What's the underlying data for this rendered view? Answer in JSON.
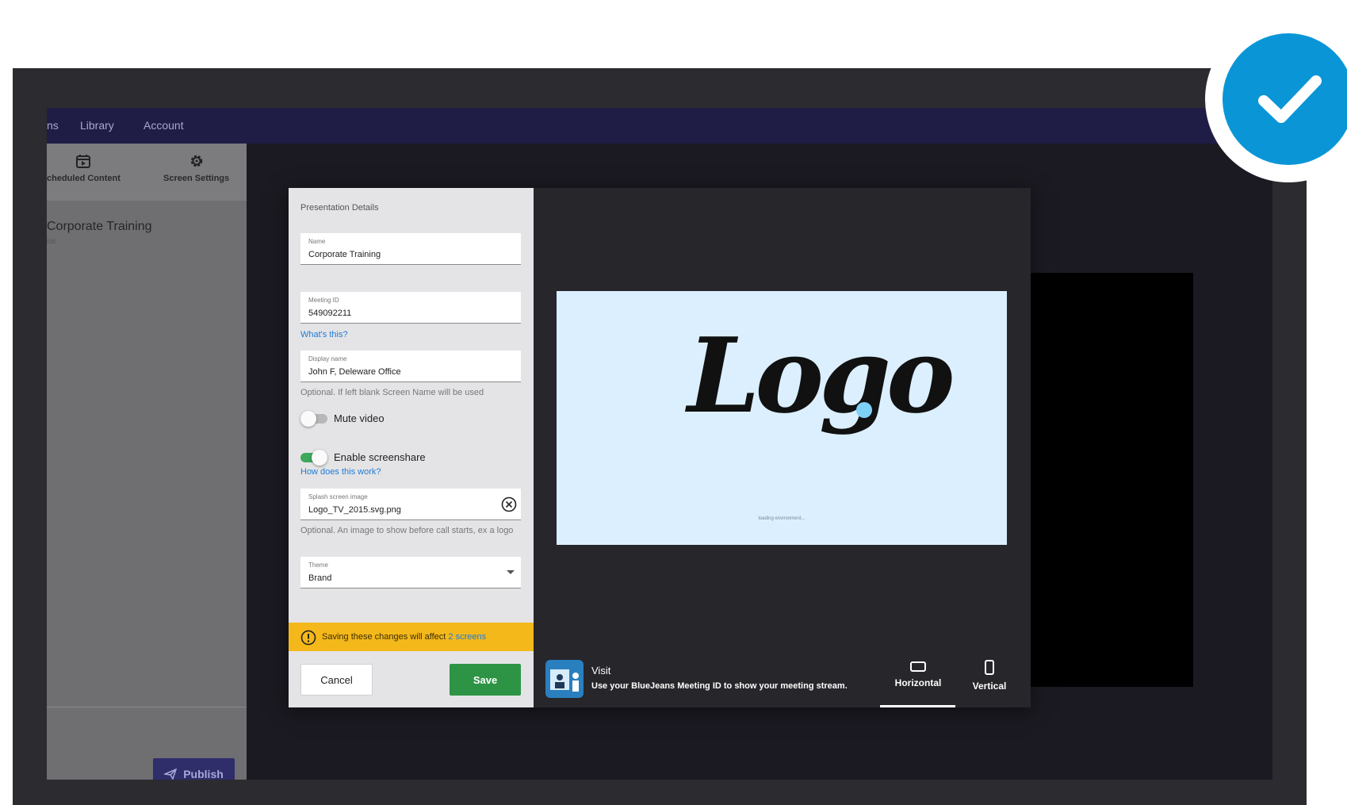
{
  "nav": {
    "items": [
      {
        "label": "ns"
      },
      {
        "label": "Library"
      },
      {
        "label": "Account"
      }
    ]
  },
  "left_panel": {
    "tabs": [
      {
        "label": "cheduled Content",
        "icon": "calendar-icon"
      },
      {
        "label": "Screen Settings",
        "icon": "gear-icon"
      }
    ],
    "presentation_title": "Corporate Training",
    "presentation_subtitle": "isit",
    "publish_label": "Publish"
  },
  "form": {
    "section_title": "Presentation Details",
    "name": {
      "label": "Name",
      "value": "Corporate Training"
    },
    "meeting_id": {
      "label": "Meeting ID",
      "value": "549092211"
    },
    "whats_this": "What's this?",
    "display_name": {
      "label": "Display name",
      "value": "John F, Deleware Office"
    },
    "display_name_helper": "Optional. If left blank Screen Name will be used",
    "mute_video": {
      "label": "Mute video",
      "on": false
    },
    "enable_screenshare": {
      "label": "Enable screenshare",
      "on": true
    },
    "how_does_this_work": "How does this work?",
    "splash": {
      "label": "Splash screen image",
      "value": "Logo_TV_2015.svg.png"
    },
    "splash_helper": "Optional. An image to show before call starts, ex a logo",
    "theme": {
      "label": "Theme",
      "value": "Brand"
    },
    "warning": {
      "text": "Saving these changes will affect ",
      "link": "2 screens"
    },
    "cancel_label": "Cancel",
    "save_label": "Save"
  },
  "preview": {
    "logo_text": "Logo",
    "loading_text": "loading environment...",
    "visit_title": "Visit",
    "visit_description": "Use your BlueJeans Meeting ID to show your meeting stream.",
    "orientations": [
      {
        "label": "Horizontal",
        "active": true
      },
      {
        "label": "Vertical",
        "active": false
      }
    ]
  },
  "colors": {
    "accent_blue": "#0a96d6",
    "save_green": "#2e9445",
    "warning_yellow": "#f4b81b",
    "nav_bg": "#1f1d45"
  }
}
